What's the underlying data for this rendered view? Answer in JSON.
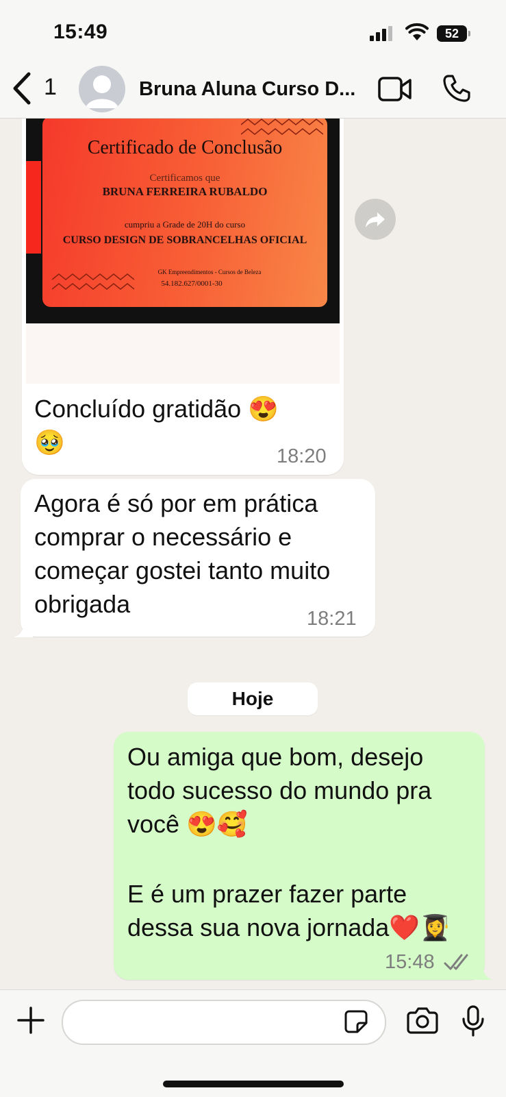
{
  "status_bar": {
    "time": "15:49",
    "battery": "52"
  },
  "header": {
    "back_count": "1",
    "contact_name": "Bruna Aluna Curso D..."
  },
  "certificate": {
    "title": "Certificado de Conclusão",
    "certify_text": "Certificamos que",
    "student_name": "BRUNA FERREIRA RUBALDO",
    "completion_text": "cumpriu a Grade de 20H do curso",
    "course_name": "CURSO DESIGN DE SOBRANCELHAS OFICIAL",
    "issuer": "GK Empreendimentos - Cursos de Beleza",
    "cnpj": "54.182.627/0001-30"
  },
  "messages": [
    {
      "text": "Concluído gratidão 😍 🥹",
      "time": "18:20"
    },
    {
      "text": "Agora é só por em prática comprar o necessário e começar gostei tanto muito obrigada",
      "time": "18:21"
    }
  ],
  "day_separator": "Hoje",
  "outgoing": {
    "line1": "Ou amiga que bom, desejo todo sucesso do mundo pra você 😍🥰",
    "line2": "E é um prazer fazer parte dessa sua nova jornada❤️👩‍🎓",
    "time": "15:48"
  },
  "icons": {
    "back": "chevron-left-icon",
    "avatar": "person-icon",
    "video": "video-icon",
    "phone": "phone-icon",
    "forward": "forward-icon",
    "plus": "plus-icon",
    "sticker": "sticker-icon",
    "camera": "camera-icon",
    "mic": "microphone-icon",
    "read_receipt": "double-check-icon"
  },
  "colors": {
    "outgoing_bubble": "#d5fbc8",
    "incoming_bubble": "#ffffff",
    "chat_background": "#f2efea"
  }
}
